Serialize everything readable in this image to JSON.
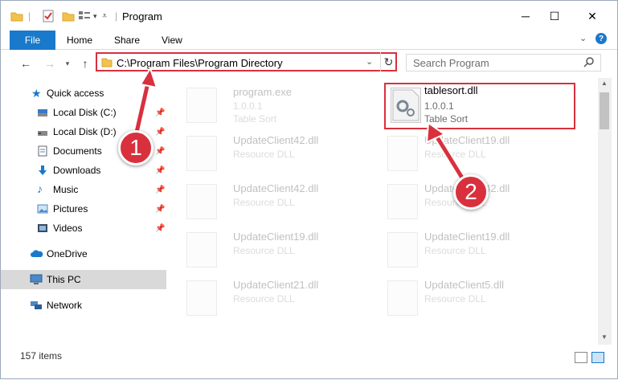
{
  "window": {
    "title": "Program",
    "minimize": "─",
    "maximize": "☐",
    "close": "✕"
  },
  "ribbon": {
    "file": "File",
    "home": "Home",
    "share": "Share",
    "view": "View"
  },
  "address": {
    "path": "C:\\Program Files\\Program Directory"
  },
  "search": {
    "placeholder": "Search Program"
  },
  "sidebar": {
    "items": [
      {
        "label": "Quick access"
      },
      {
        "label": "Local Disk (C:)"
      },
      {
        "label": "Local Disk (D:)"
      },
      {
        "label": "Documents"
      },
      {
        "label": "Downloads"
      },
      {
        "label": "Music"
      },
      {
        "label": "Pictures"
      },
      {
        "label": "Videos"
      },
      {
        "label": "OneDrive"
      },
      {
        "label": "This PC"
      },
      {
        "label": "Network"
      }
    ]
  },
  "files": [
    {
      "name": "program.exe",
      "line1": "1.0.0.1",
      "line2": "Table Sort"
    },
    {
      "name": "tablesort.dll",
      "line1": "1.0.0.1",
      "line2": "Table Sort"
    },
    {
      "name": "UpdateClient42.dll",
      "line1": "Resource DLL",
      "line2": ""
    },
    {
      "name": "UpdateClient19.dll",
      "line1": "Resource DLL",
      "line2": ""
    },
    {
      "name": "UpdateClient42.dll",
      "line1": "Resource DLL",
      "line2": ""
    },
    {
      "name": "UpdateClient42.dll",
      "line1": "Resource DLL",
      "line2": ""
    },
    {
      "name": "UpdateClient19.dll",
      "line1": "Resource DLL",
      "line2": ""
    },
    {
      "name": "UpdateClient19.dll",
      "line1": "Resource DLL",
      "line2": ""
    },
    {
      "name": "UpdateClient21.dll",
      "line1": "Resource DLL",
      "line2": ""
    },
    {
      "name": "UpdateClient5.dll",
      "line1": "Resource DLL",
      "line2": ""
    }
  ],
  "status": {
    "count": "157 items"
  },
  "callouts": {
    "one": "1",
    "two": "2"
  },
  "colors": {
    "accent": "#1979ca",
    "highlight": "#d9303e"
  }
}
